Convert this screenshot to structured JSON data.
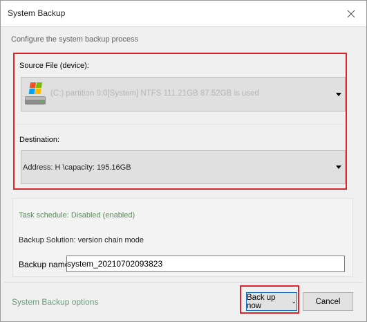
{
  "window": {
    "title": "System Backup"
  },
  "subtitle": "Configure the system backup process",
  "source": {
    "label": "Source File (device):",
    "value": "(C:) partition 0:0[System] NTFS 111.21GB 87.52GB is used"
  },
  "destination": {
    "label": "Destination:",
    "value": "Address: H \\capacity: 195.16GB"
  },
  "task_schedule": "Task schedule: Disabled (enabled)",
  "backup_solution": "Backup Solution: version chain mode",
  "backup_name": {
    "label": "Backup name:",
    "value": "system_20210702093823"
  },
  "footer": {
    "options_link": "System Backup options",
    "backup_now": "Back up now",
    "backup_chevron": "⌄",
    "cancel": "Cancel"
  },
  "colors": {
    "highlight": "#d9262c",
    "focus": "#0a64c8",
    "link": "#6a9a7a"
  },
  "icons": {
    "close": "close-icon",
    "drive": "system-drive-icon",
    "dropdown": "dropdown-arrow-icon"
  }
}
